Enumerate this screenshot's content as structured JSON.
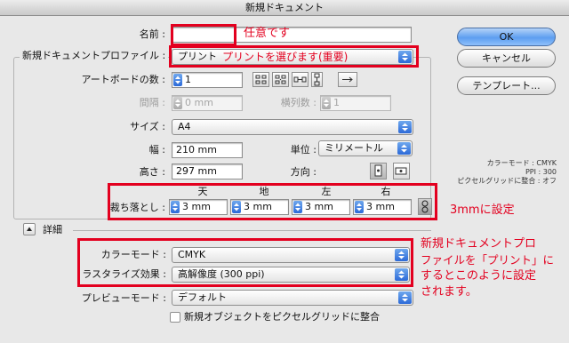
{
  "window": {
    "title": "新規ドキュメント"
  },
  "name": {
    "label": "名前 :",
    "value": ""
  },
  "profile": {
    "group_label": "新規ドキュメントプロファイル :",
    "selected": "プリント"
  },
  "artboards": {
    "count_label": "アートボードの数 :",
    "count_value": "1",
    "spacing_label": "間隔 :",
    "spacing_value": "0 mm",
    "columns_label": "横列数 :",
    "columns_value": "1"
  },
  "size": {
    "label": "サイズ :",
    "selected": "A4"
  },
  "width": {
    "label": "幅 :",
    "value": "210 mm"
  },
  "height": {
    "label": "高さ :",
    "value": "297 mm"
  },
  "units": {
    "label": "単位 :",
    "selected": "ミリメートル"
  },
  "orientation": {
    "label": "方向 :"
  },
  "bleed": {
    "label": "裁ち落とし :",
    "headers": [
      "天",
      "地",
      "左",
      "右"
    ],
    "values": [
      "3 mm",
      "3 mm",
      "3 mm",
      "3 mm"
    ]
  },
  "advanced": {
    "label": "詳細",
    "color_mode_label": "カラーモード :",
    "color_mode": "CMYK",
    "raster_label": "ラスタライズ効果 :",
    "raster": "高解像度 (300 ppi)",
    "preview_label": "プレビューモード :",
    "preview": "デフォルト",
    "align_label": "新規オブジェクトをピクセルグリッドに整合"
  },
  "buttons": {
    "ok": "OK",
    "cancel": "キャンセル",
    "templates": "テンプレート..."
  },
  "info": {
    "lines": [
      "カラーモード : CMYK",
      "PPI : 300",
      "ピクセルグリッドに整合 : オフ"
    ]
  },
  "annotations": {
    "name": "任意です",
    "profile": "プリントを選びます(重要)",
    "bleed": "3mmに設定",
    "profile_note": [
      "新規ドキュメントプロ",
      "ファイルを「プリント」に",
      "するとこのように設定",
      "されます。"
    ]
  },
  "colors": {
    "annotation_red": "#e3001f",
    "accent_blue": "#2c6ad8"
  }
}
